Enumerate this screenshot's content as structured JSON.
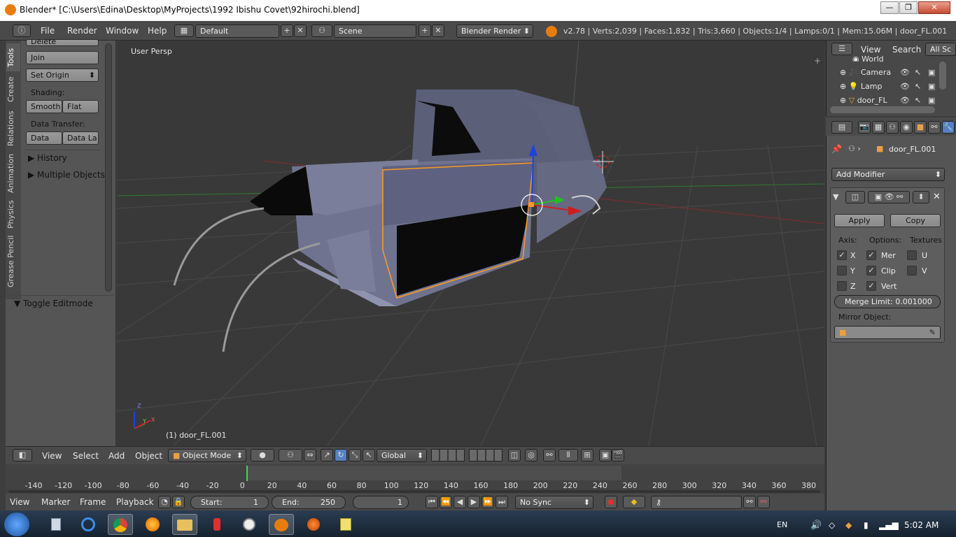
{
  "window": {
    "title": "Blender* [C:\\Users\\Edina\\Desktop\\MyProjects\\1992 Ibishu Covet\\92hirochi.blend]",
    "minimize": "—",
    "maximize": "❐",
    "close": "✕"
  },
  "info_header": {
    "menus": [
      "File",
      "Render",
      "Window",
      "Help"
    ],
    "layout": "Default",
    "scene": "Scene",
    "engine": "Blender Render",
    "stats": "v2.78 | Verts:2,039 | Faces:1,832 | Tris:3,660 | Objects:1/4 | Lamps:0/1 | Mem:15.06M | door_FL.001"
  },
  "tool_shelf": {
    "tabs": [
      "Tools",
      "Create",
      "Relations",
      "Animation",
      "Physics",
      "Grease Pencil"
    ],
    "delete_label": "Delete",
    "join_label": "Join",
    "set_origin_label": "Set Origin",
    "shading_label": "Shading:",
    "smooth_label": "Smooth",
    "flat_label": "Flat",
    "data_transfer_label": "Data Transfer:",
    "data_label": "Data",
    "data_la_label": "Data La",
    "history_label": "History",
    "multiple_objects_label": "Multiple Objects",
    "toggle_editmode_label": "Toggle Editmode"
  },
  "viewport": {
    "view_name": "User Persp",
    "active_object": "(1) door_FL.001",
    "axis_labels": [
      "Z",
      "Y",
      "X"
    ]
  },
  "view3d_header": {
    "menus": [
      "View",
      "Select",
      "Add",
      "Object"
    ],
    "mode": "Object Mode",
    "orientation": "Global"
  },
  "timeline": {
    "ticks": [
      "-140",
      "-120",
      "-100",
      "-80",
      "-60",
      "-40",
      "-20",
      "0",
      "20",
      "40",
      "60",
      "80",
      "100",
      "120",
      "140",
      "160",
      "180",
      "200",
      "220",
      "240",
      "260",
      "280",
      "300",
      "320",
      "340",
      "360",
      "380"
    ],
    "menus": [
      "View",
      "Marker",
      "Frame",
      "Playback"
    ],
    "start_label": "Start:",
    "start_value": "1",
    "end_label": "End:",
    "end_value": "250",
    "current_frame": "1",
    "sync": "No Sync"
  },
  "outliner": {
    "menus": [
      "View",
      "Search"
    ],
    "filter": "All Sc",
    "items": [
      "World",
      "Camera",
      "Lamp",
      "door_FL"
    ]
  },
  "properties": {
    "object_name": "door_FL.001",
    "add_modifier": "Add Modifier",
    "apply_label": "Apply",
    "copy_label": "Copy",
    "axis_label": "Axis:",
    "options_label": "Options:",
    "textures_label": "Textures",
    "axis_x": "X",
    "axis_y": "Y",
    "axis_z": "Z",
    "opt_mer": "Mer",
    "opt_clip": "Clip",
    "opt_vert": "Vert",
    "tex_u": "U",
    "tex_v": "V",
    "merge_limit_label": "Merge Limit:",
    "merge_limit_value": "0.001000",
    "mirror_object_label": "Mirror Object:"
  },
  "taskbar": {
    "language": "EN",
    "clock": "5:02 AM"
  },
  "colors": {
    "blender_orange": "#e87d0d",
    "selection_orange": "#ff9a1f",
    "axis_red": "#cc2020",
    "axis_green": "#20c020",
    "axis_blue": "#2040e0"
  }
}
